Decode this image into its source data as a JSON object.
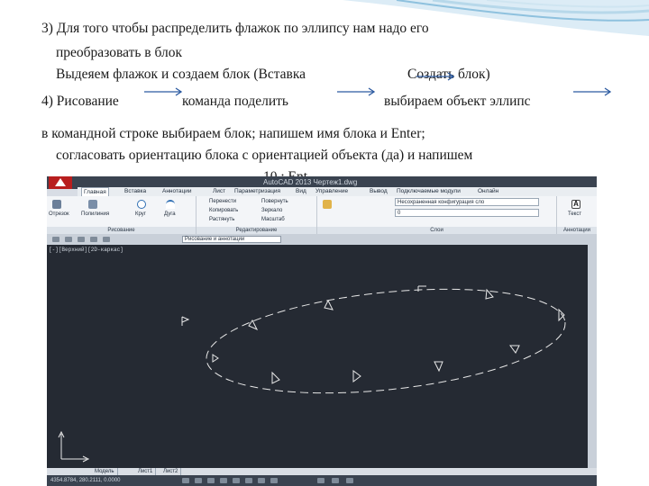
{
  "slide": {
    "line1": "3) Для того чтобы распределить флажок по эллипсу нам надо его",
    "line2": "преобразовать в блок",
    "line3a": "Выдеяем флажок и создаем блок (Вставка",
    "line3b": "Создать блок)",
    "line4a": "4) Рисование",
    "line4b": "команда поделить",
    "line4c": "выбираем объект эллипс",
    "line5": "в командной строке выбираем блок; напишем имя блока и Enter;",
    "line6": "согласовать ориентацию блока с ориентацией объекта (да) и напишем",
    "line7": "10 ; Ent"
  },
  "colors": {
    "arrow": "#2c5aa0",
    "swoosh": "#7fb3d5",
    "canvas": "#252a33"
  },
  "screenshot": {
    "title": "AutoCAD 2013   Чертеж1.dwg",
    "tabs": [
      "Главная",
      "Вставка",
      "Аннотации",
      "Лист",
      "Параметризация",
      "Вид",
      "Управление",
      "Вывод",
      "Подключаемые модули",
      "Онлайн"
    ],
    "ribbon": {
      "draw_label": "Рисование",
      "modify_label": "Редактирование",
      "layers_label": "Слои",
      "annot_label": "Аннотации",
      "draw_tools": [
        "Отрезок",
        "Полилиния",
        "Круг",
        "Дуга"
      ],
      "modify_tools": [
        "Перенести",
        "Копировать",
        "Растянуть"
      ],
      "modify_tools2": [
        "Повернуть",
        "Зеркало",
        "Масштаб"
      ],
      "layer_combo": "Несохраненная конфигурация сло",
      "layer_zero": "0",
      "text_tool": "Текст"
    },
    "workspace": "Рисование и аннотации",
    "viewport": "[-][Верхний][2D-каркас]",
    "layout_tabs": [
      "Модель",
      "Лист1",
      "Лист2"
    ],
    "coords": "4354.8784, 280.2111, 0.0000"
  }
}
